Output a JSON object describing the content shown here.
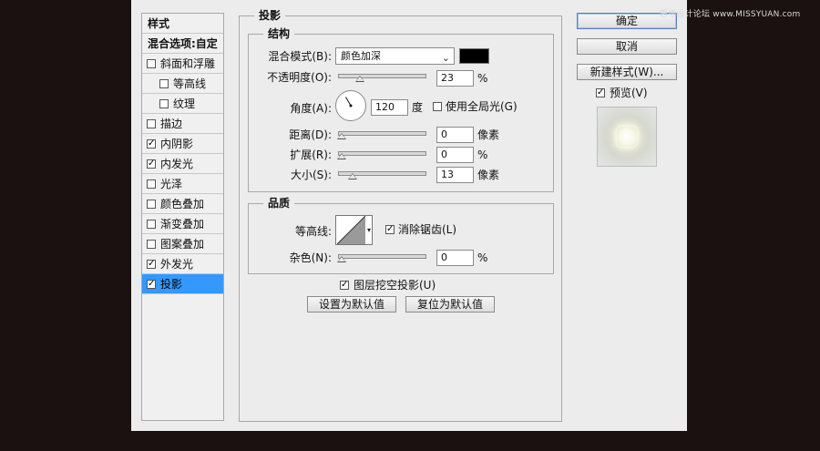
{
  "watermark": "思缘设计论坛 www.MISSYUAN.com",
  "styles_panel": {
    "title": "样式",
    "blend_options": "混合选项:自定",
    "items": [
      {
        "label": "斜面和浮雕",
        "checked": false,
        "indent": false
      },
      {
        "label": "等高线",
        "checked": false,
        "indent": true
      },
      {
        "label": "纹理",
        "checked": false,
        "indent": true
      },
      {
        "label": "描边",
        "checked": false,
        "indent": false
      },
      {
        "label": "内阴影",
        "checked": true,
        "indent": false
      },
      {
        "label": "内发光",
        "checked": true,
        "indent": false
      },
      {
        "label": "光泽",
        "checked": false,
        "indent": false
      },
      {
        "label": "颜色叠加",
        "checked": false,
        "indent": false
      },
      {
        "label": "渐变叠加",
        "checked": false,
        "indent": false
      },
      {
        "label": "图案叠加",
        "checked": false,
        "indent": false
      },
      {
        "label": "外发光",
        "checked": true,
        "indent": false
      },
      {
        "label": "投影",
        "checked": true,
        "indent": false,
        "selected": true
      }
    ]
  },
  "drop_shadow": {
    "title": "投影",
    "structure": {
      "title": "结构",
      "blend_mode_label": "混合模式(B):",
      "blend_mode_value": "颜色加深",
      "blend_color": "#000000",
      "opacity_label": "不透明度(O):",
      "opacity_value": "23",
      "opacity_unit": "%",
      "angle_label": "角度(A):",
      "angle_value": "120",
      "angle_unit": "度",
      "global_light_label": "使用全局光(G)",
      "global_light_checked": false,
      "distance_label": "距离(D):",
      "distance_value": "0",
      "distance_unit": "像素",
      "spread_label": "扩展(R):",
      "spread_value": "0",
      "spread_unit": "%",
      "size_label": "大小(S):",
      "size_value": "13",
      "size_unit": "像素"
    },
    "quality": {
      "title": "品质",
      "contour_label": "等高线:",
      "anti_alias_label": "消除锯齿(L)",
      "anti_alias_checked": true,
      "noise_label": "杂色(N):",
      "noise_value": "0",
      "noise_unit": "%"
    },
    "layer_knockout_label": "图层挖空投影(U)",
    "layer_knockout_checked": true,
    "make_default_label": "设置为默认值",
    "reset_default_label": "复位为默认值"
  },
  "buttons": {
    "ok": "确定",
    "cancel": "取消",
    "new_style": "新建样式(W)..."
  },
  "preview": {
    "label": "预览(V)",
    "checked": true
  }
}
